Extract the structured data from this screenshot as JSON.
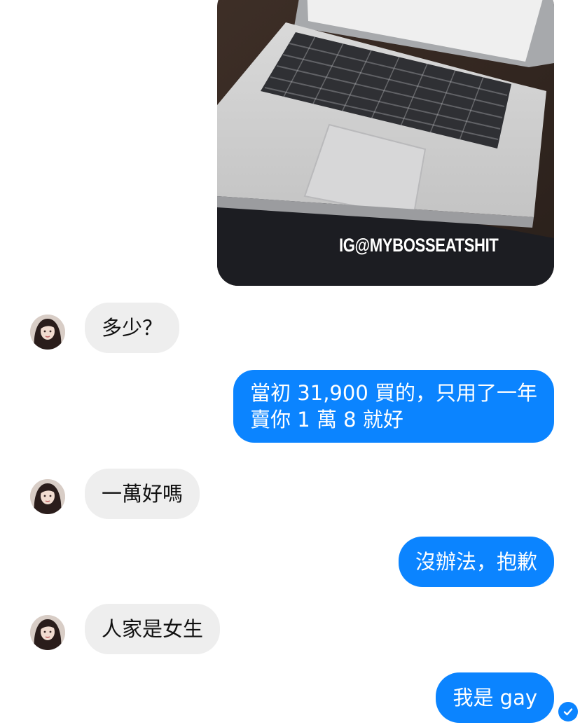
{
  "thread": {
    "image_watermark": "IG@MYBOSSEATSHIT",
    "messages": [
      {
        "from": "them",
        "text": "多少？"
      },
      {
        "from": "me",
        "lines": [
          "當初 31,900 買的，只用了一年",
          "賣你 1 萬 8 就好"
        ]
      },
      {
        "from": "them",
        "text": "一萬好嗎"
      },
      {
        "from": "me",
        "text": "沒辦法，抱歉"
      },
      {
        "from": "them",
        "text": "人家是女生"
      },
      {
        "from": "me",
        "text": "我是 gay"
      }
    ]
  },
  "colors": {
    "outgoing_bubble": "#0b84ff",
    "incoming_bubble": "#eeeeee",
    "background": "#ffffff"
  },
  "icons": {
    "seen_indicator": "checkmark-circle-icon",
    "avatar": "contact-avatar"
  }
}
